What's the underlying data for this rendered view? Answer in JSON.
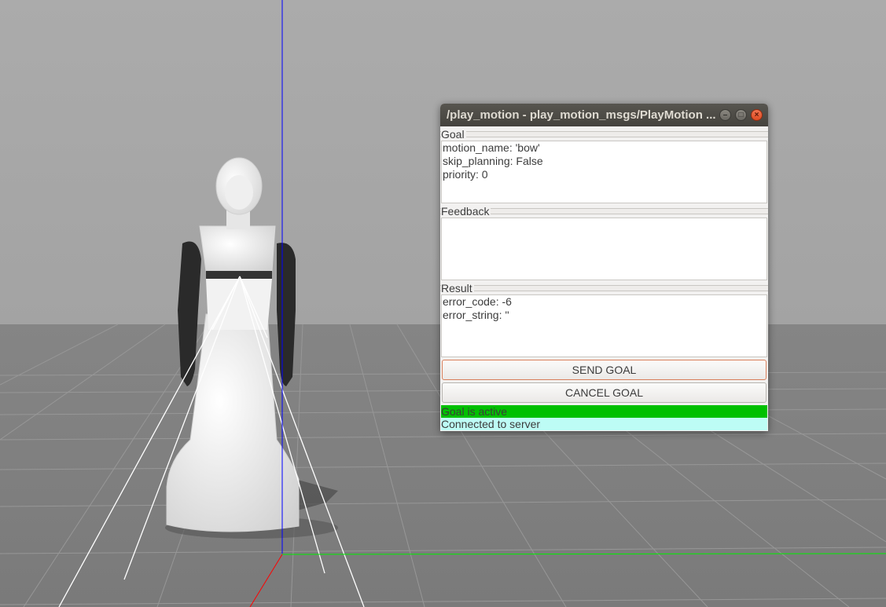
{
  "window": {
    "title": "/play_motion - play_motion_msgs/PlayMotion ...",
    "minimize_glyph": "–",
    "maximize_glyph": "□",
    "close_glyph": "×"
  },
  "goal": {
    "label": "Goal",
    "lines": [
      "motion_name: 'bow'",
      "skip_planning: False",
      "priority: 0"
    ]
  },
  "feedback": {
    "label": "Feedback",
    "lines": []
  },
  "result": {
    "label": "Result",
    "lines": [
      "error_code: -6",
      "error_string: ''"
    ]
  },
  "buttons": {
    "send_goal": "SEND GOAL",
    "cancel_goal": "CANCEL GOAL"
  },
  "status": {
    "goal_state": "Goal is active",
    "goal_state_color": "#00c000",
    "connection": "Connected to server",
    "connection_color": "#bdfcf5"
  },
  "scene": {
    "sky_color": "#a9a9a9",
    "ground_color": "#7e7e7e",
    "z_axis_color": "#0000ff",
    "x_axis_color": "#ff0000",
    "y_axis_color": "#00ff00",
    "robot_body_color": "#f4f4f4",
    "robot_arm_color": "#2a2a2a"
  }
}
